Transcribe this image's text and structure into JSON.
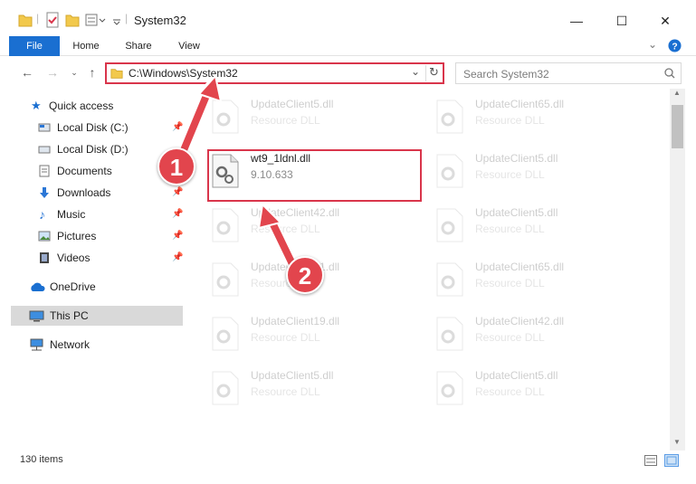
{
  "window": {
    "title": "System32",
    "minimize": "—",
    "maximize": "☐",
    "close": "✕"
  },
  "ribbon": {
    "tabs": [
      "File",
      "Home",
      "Share",
      "View"
    ]
  },
  "address": {
    "path": "C:\\Windows\\System32",
    "refresh": "↻"
  },
  "search": {
    "placeholder": "Search System32"
  },
  "sidebar": {
    "items": [
      {
        "label": "Quick access",
        "icon": "star-icon"
      },
      {
        "label": "Local Disk (C:)",
        "icon": "drive-icon"
      },
      {
        "label": "Local Disk (D:)",
        "icon": "drive-icon"
      },
      {
        "label": "Documents",
        "icon": "documents-icon"
      },
      {
        "label": "Downloads",
        "icon": "download-icon"
      },
      {
        "label": "Music",
        "icon": "music-icon"
      },
      {
        "label": "Pictures",
        "icon": "pictures-icon"
      },
      {
        "label": "Videos",
        "icon": "videos-icon"
      },
      {
        "label": "OneDrive",
        "icon": "cloud-icon"
      },
      {
        "label": "This PC",
        "icon": "computer-icon"
      },
      {
        "label": "Network",
        "icon": "network-icon"
      }
    ]
  },
  "files": [
    {
      "name": "UpdateClient5.dll",
      "desc": "Resource DLL"
    },
    {
      "name": "UpdateClient65.dll",
      "desc": "Resource DLL"
    },
    {
      "name": "wt9_1ldnl.dll",
      "desc": "9.10.633"
    },
    {
      "name": "UpdateClient5.dll",
      "desc": "Resource DLL"
    },
    {
      "name": "UpdateClient42.dll",
      "desc": "Resource DLL"
    },
    {
      "name": "UpdateClient5.dll",
      "desc": "Resource DLL"
    },
    {
      "name": "UpdateClient21.dll",
      "desc": "Resource DLL"
    },
    {
      "name": "UpdateClient65.dll",
      "desc": "Resource DLL"
    },
    {
      "name": "UpdateClient19.dll",
      "desc": "Resource DLL"
    },
    {
      "name": "UpdateClient42.dll",
      "desc": "Resource DLL"
    },
    {
      "name": "UpdateClient5.dll",
      "desc": "Resource DLL"
    },
    {
      "name": "UpdateClient5.dll",
      "desc": "Resource DLL"
    }
  ],
  "status": {
    "item_count": "130 items"
  },
  "annotations": {
    "marker1": "1",
    "marker2": "2"
  },
  "colors": {
    "accent": "#1a6fd1",
    "highlight": "#d9354b",
    "marker": "#e2454d"
  }
}
